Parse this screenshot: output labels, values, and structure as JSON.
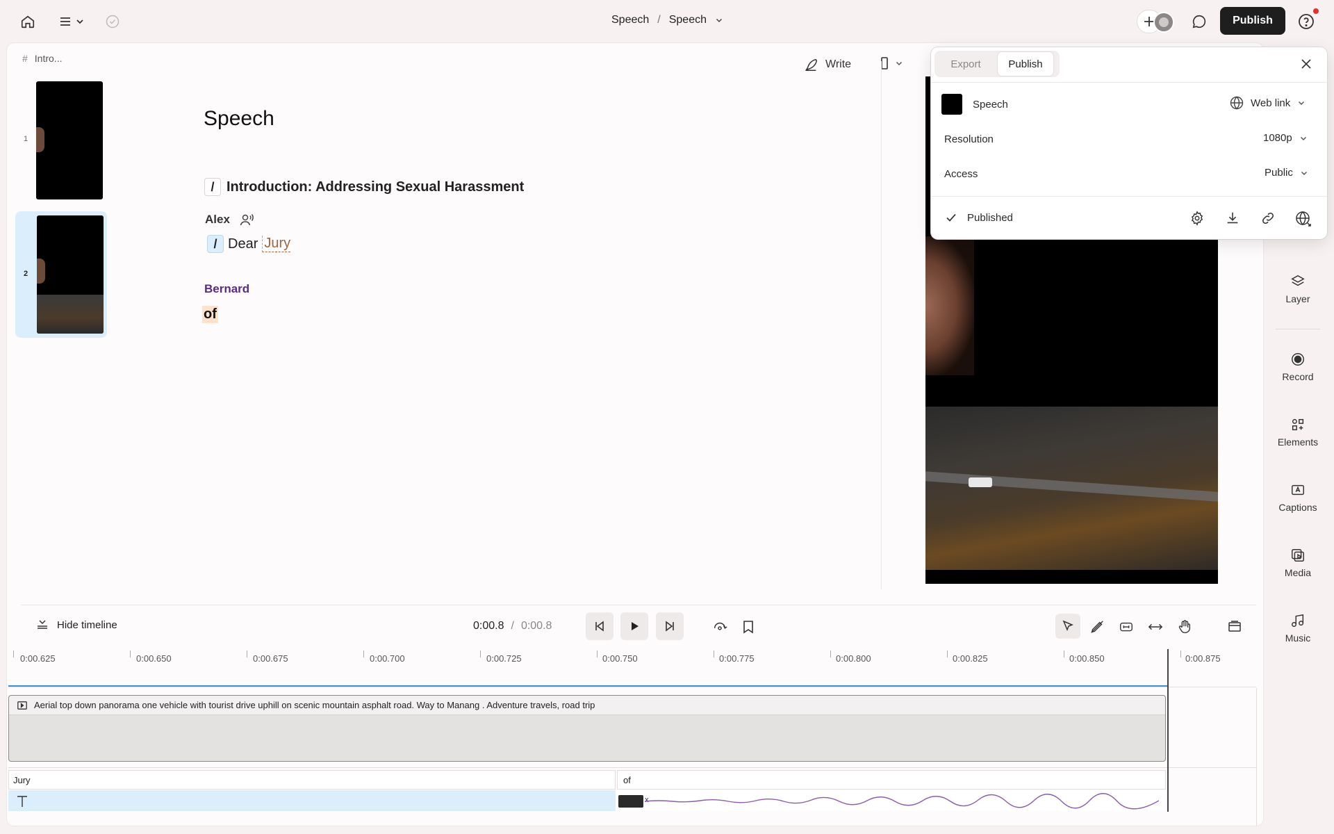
{
  "topbar": {
    "breadcrumb_project": "Speech",
    "breadcrumb_sep": "/",
    "breadcrumb_composition": "Speech",
    "publish_label": "Publish"
  },
  "scenes": {
    "header": "Intro...",
    "items": [
      {
        "number": "1"
      },
      {
        "number": "2"
      }
    ]
  },
  "script": {
    "title": "Speech",
    "heading_slash": "/",
    "heading": "Introduction: Addressing Sexual Harassment",
    "speaker1": "Alex",
    "line1_slash": "/",
    "line1_word1": "Dear",
    "line1_word2": "Jury",
    "speaker2": "Bernard",
    "line2_word": "of"
  },
  "toolbar": {
    "write_label": "Write"
  },
  "publish_panel": {
    "tab_export": "Export",
    "tab_publish": "Publish",
    "item_name": "Speech",
    "link_type": "Web link",
    "resolution_label": "Resolution",
    "resolution_value": "1080p",
    "access_label": "Access",
    "access_value": "Public",
    "status": "Published"
  },
  "rail": {
    "layer": "Layer",
    "record": "Record",
    "elements": "Elements",
    "captions": "Captions",
    "media": "Media",
    "music": "Music"
  },
  "timeline": {
    "hide_label": "Hide timeline",
    "current_time": "0:00.8",
    "time_sep": "/",
    "total_time": "0:00.8",
    "ticks": [
      "0:00.625",
      "0:00.650",
      "0:00.675",
      "0:00.700",
      "0:00.725",
      "0:00.750",
      "0:00.775",
      "0:00.800",
      "0:00.825",
      "0:00.850",
      "0:00.875"
    ],
    "clip_title": "Aerial top down panorama one vehicle with tourist drive uphill on scenic mountain asphalt road. Way to Manang . Adventure travels, road trip",
    "word1": "Jury",
    "word2": "of",
    "word2_suffix": "x"
  },
  "colors": {
    "accent_blue": "#3b8ee0",
    "speaker2_purple": "#5b2a86",
    "selection_blue": "#dbeefb",
    "highlight_peach": "#fbe3cc",
    "notification_red": "#e0312b"
  }
}
